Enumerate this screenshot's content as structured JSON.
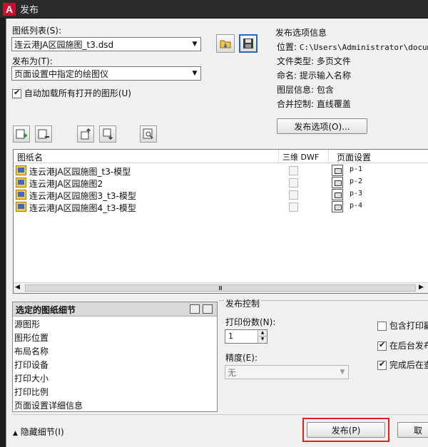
{
  "window": {
    "title": "发布",
    "app_icon_letter": "A"
  },
  "sheet_list": {
    "label": "图纸列表(S):",
    "value": "连云港JA区园施图_t3.dsd"
  },
  "publish_to": {
    "label": "发布为(T):",
    "value": "页面设置中指定的绘图仪"
  },
  "auto_load": {
    "label": "自动加载所有打开的图形(U)",
    "checked": true
  },
  "options_info": {
    "title": "发布选项信息",
    "location_label": "位置:",
    "location_value": "C:\\Users\\Administrator\\documen",
    "filetype_label": "文件类型:",
    "filetype_value": "多页文件",
    "naming_label": "命名:",
    "naming_value": "提示输入名称",
    "layer_label": "图层信息:",
    "layer_value": "包含",
    "merge_label": "合并控制:",
    "merge_value": "直线覆盖",
    "options_button": "发布选项(O)..."
  },
  "list": {
    "col_sheet": "图纸名",
    "col_3d": "三维 DWF",
    "col_pagesetup": "页面设置",
    "rows": [
      {
        "name": "连云港JA区园施图_t3-模型",
        "page": "p-1"
      },
      {
        "name": "连云港JA区园施图2",
        "page": "p-2"
      },
      {
        "name": "连云港JA区园施图3_t3-模型",
        "page": "p-3"
      },
      {
        "name": "连云港JA区园施图4_t3-模型",
        "page": "p-4"
      }
    ],
    "scroll_grip": "Ⅲ"
  },
  "details": {
    "title": "选定的图纸细节",
    "items": [
      "源图形",
      "图形位置",
      "布局名称",
      "打印设备",
      "打印大小",
      "打印比例",
      "页面设置详细信息"
    ]
  },
  "publish_control": {
    "title": "发布控制",
    "copies_label": "打印份数(N):",
    "copies_value": "1",
    "precision_label": "精度(E):",
    "precision_value": "无",
    "include_stamp": {
      "label": "包含打印戳",
      "checked": false
    },
    "background": {
      "label": "在后台发布",
      "checked": true
    },
    "open_after": {
      "label": "完成后在查",
      "checked": true
    }
  },
  "footer": {
    "hide_details": "隐藏细节(I)",
    "publish_button": "发布(P)",
    "cancel_button": "取"
  }
}
